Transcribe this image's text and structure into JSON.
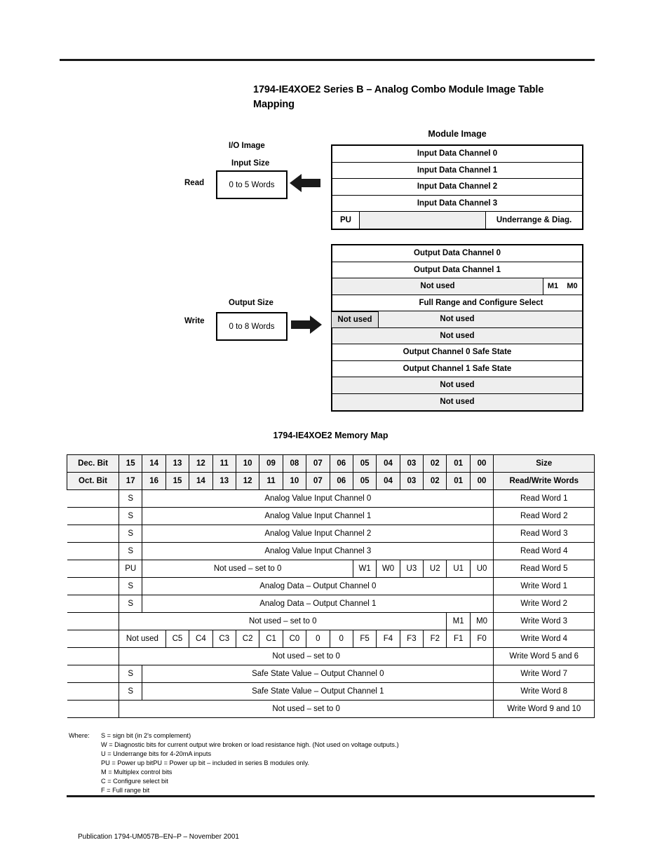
{
  "heading": "1794-IE4XOE2 Series B – Analog Combo Module Image Table Mapping",
  "module_image": {
    "title": "Module Image",
    "input_rows": [
      {
        "label": "Input Data Channel 0"
      },
      {
        "label": "Input Data Channel 1"
      },
      {
        "label": "Input Data Channel 2"
      },
      {
        "label": "Input Data Channel 3"
      }
    ],
    "input_pu_row": {
      "pu": "PU",
      "middle": "",
      "right": "Underrange & Diag."
    },
    "output_rows": [
      {
        "label": "Output Data Channel 0"
      },
      {
        "label": "Output Data Channel 1"
      },
      {
        "label": "Not used",
        "m1": "M1",
        "m0": "M0"
      },
      {
        "label": "Full Range and Configure Select",
        "tab": "Not used"
      },
      {
        "label": "Not used"
      },
      {
        "label": "Not used"
      },
      {
        "label": "Output Channel 0 Safe State"
      },
      {
        "label": "Output Channel 1 Safe State"
      },
      {
        "label": "Not used"
      },
      {
        "label": "Not used"
      }
    ]
  },
  "io_image": {
    "title": "I/O Image",
    "input_size_label": "Input Size",
    "input_size_value": "0 to 5 Words",
    "read_label": "Read",
    "output_size_label": "Output Size",
    "output_size_value": "0 to 8 Words",
    "write_label": "Write"
  },
  "memory_map": {
    "title": "1794-IE4XOE2 Memory Map",
    "header_dec": {
      "label": "Dec. Bit",
      "bits": [
        "15",
        "14",
        "13",
        "12",
        "11",
        "10",
        "09",
        "08",
        "07",
        "06",
        "05",
        "04",
        "03",
        "02",
        "01",
        "00"
      ],
      "size": "Size"
    },
    "header_oct": {
      "label": "Oct. Bit",
      "bits": [
        "17",
        "16",
        "15",
        "14",
        "13",
        "12",
        "11",
        "10",
        "07",
        "06",
        "05",
        "04",
        "03",
        "02",
        "01",
        "00"
      ],
      "size": "Read/Write Words"
    },
    "rows": [
      {
        "sign": "S",
        "body": "Analog Value Input Channel 0",
        "size": "Read Word 1"
      },
      {
        "sign": "S",
        "body": "Analog Value Input Channel 1",
        "size": "Read Word 2"
      },
      {
        "sign": "S",
        "body": "Analog Value Input Channel 2",
        "size": "Read Word 3"
      },
      {
        "sign": "S",
        "body": "Analog Value Input Channel 3",
        "size": "Read Word 4"
      },
      {
        "sign": "PU",
        "body": "Not used – set to 0",
        "bits": [
          "W1",
          "W0",
          "U3",
          "U2",
          "U1",
          "U0"
        ],
        "size": "Read Word 5"
      },
      {
        "sign": "S",
        "body": "Analog Data – Output Channel 0",
        "size": "Write Word 1"
      },
      {
        "sign": "S",
        "body": "Analog Data – Output Channel 1",
        "size": "Write Word 2"
      },
      {
        "body": "Not used – set to 0",
        "bits": [
          "M1",
          "M0"
        ],
        "size": "Write Word 3"
      },
      {
        "body": "Not used",
        "bits": [
          "C5",
          "C4",
          "C3",
          "C2",
          "C1",
          "C0",
          "0",
          "0",
          "F5",
          "F4",
          "F3",
          "F2",
          "F1",
          "F0"
        ],
        "size": "Write Word 4"
      },
      {
        "body": "Not used – set to 0",
        "size": "Write Word 5 and 6"
      },
      {
        "sign": "S",
        "body": "Safe State Value – Output Channel 0",
        "size": "Write Word 7"
      },
      {
        "sign": "S",
        "body": "Safe State Value – Output Channel 1",
        "size": "Write Word 8"
      },
      {
        "body": "Not used – set to 0",
        "size": "Write Word 9 and 10"
      }
    ]
  },
  "legend": {
    "where": "Where:",
    "items": [
      "S = sign bit (in 2's complement)",
      "W = Diagnostic bits for current output wire broken or load resistance high. (Not used on voltage outputs.)",
      "U = Underrange bits for 4-20mA inputs",
      "PU = Power up bitPU = Power up bit – included in series B modules only.",
      "M = Multiplex control bits",
      "C = Configure select bit",
      "F = Full range bit"
    ]
  },
  "footer": "Publication 1794-UM057B–EN–P – November 2001"
}
